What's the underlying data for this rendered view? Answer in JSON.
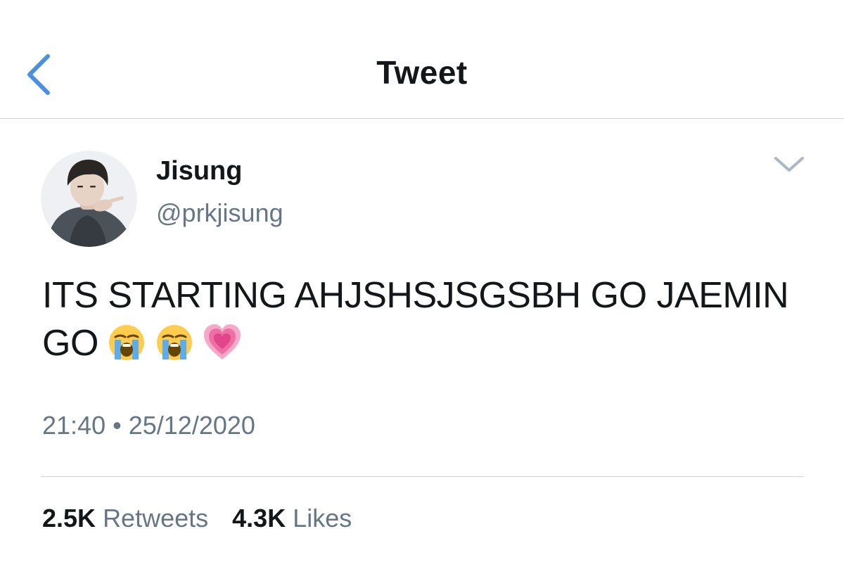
{
  "nav": {
    "title": "Tweet",
    "back_icon": "chevron-left-icon",
    "accent_color": "#4a90e2"
  },
  "tweet": {
    "author": {
      "display_name": "Jisung",
      "handle": "@prkjisung",
      "avatar": "user-photo-avatar"
    },
    "text": "ITS STARTING AHJSHSJSGSBH GO JAEMIN GO",
    "emojis": [
      "loudly-crying-face-emoji",
      "loudly-crying-face-emoji",
      "growing-heart-emoji"
    ],
    "time": "21:40",
    "separator": "•",
    "date": "25/12/2020",
    "more_icon": "chevron-down-icon",
    "stats": {
      "retweets_count": "2.5K",
      "retweets_label": "Retweets",
      "likes_count": "4.3K",
      "likes_label": "Likes"
    }
  },
  "colors": {
    "text_primary": "#14171a",
    "text_secondary": "#657786",
    "divider": "#cfd3d6"
  }
}
